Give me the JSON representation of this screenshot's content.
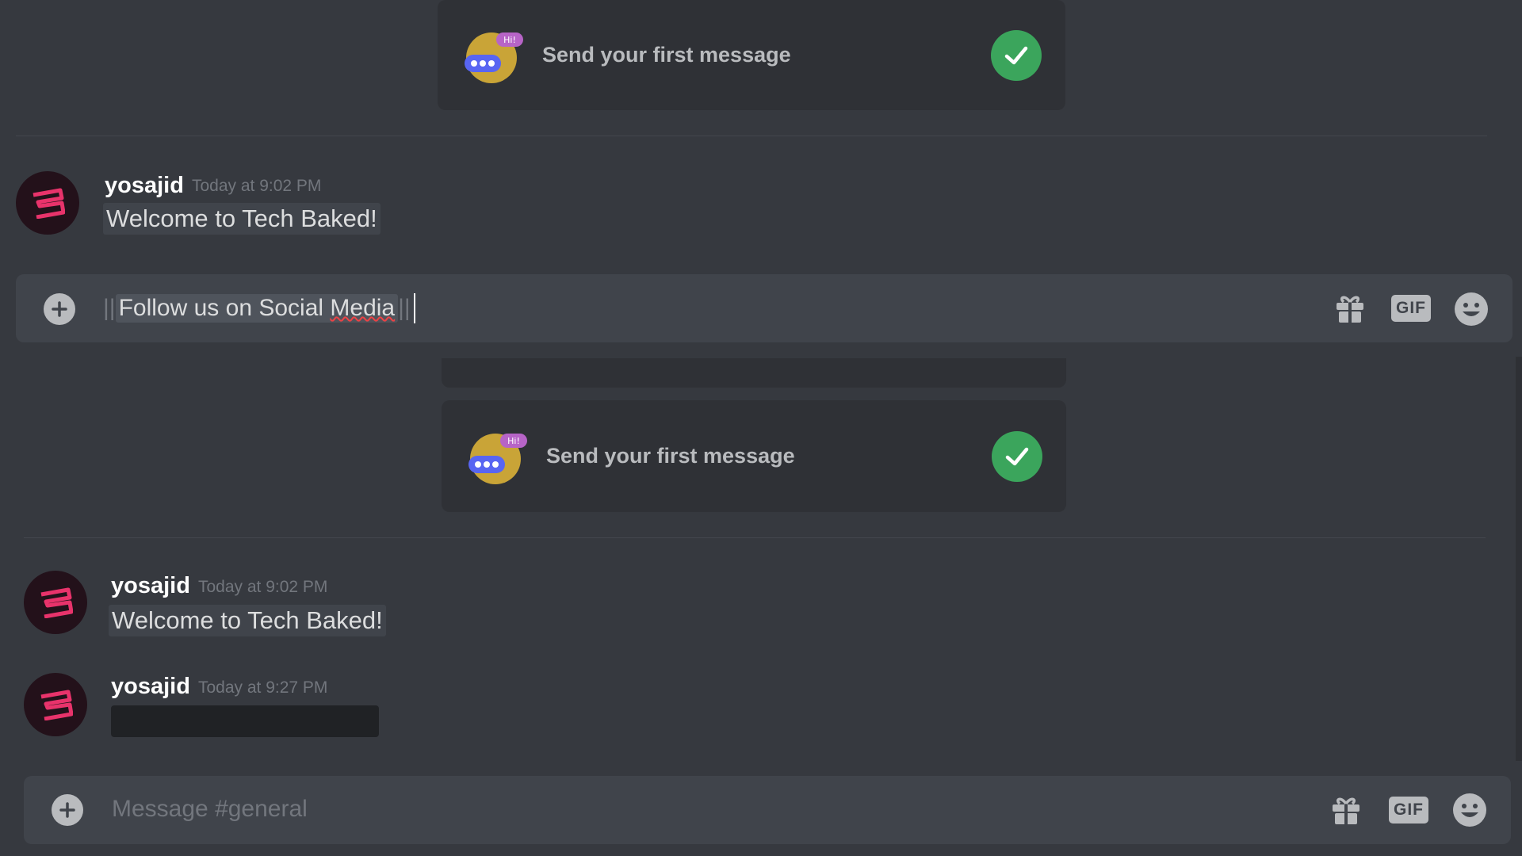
{
  "welcome_cards": [
    {
      "title": "Send your first message",
      "badge": "Hi!"
    },
    {
      "title": "Send your first message",
      "badge": "Hi!"
    }
  ],
  "messages_top": [
    {
      "username": "yosajid",
      "timestamp": "Today at 9:02 PM",
      "text": "Welcome to Tech Baked!"
    }
  ],
  "messages_bottom": [
    {
      "username": "yosajid",
      "timestamp": "Today at 9:02 PM",
      "text": "Welcome to Tech Baked!"
    },
    {
      "username": "yosajid",
      "timestamp": "Today at 9:27 PM",
      "text": ""
    }
  ],
  "edit_composer": {
    "spoiler_open": "||",
    "value_part1": "Follow us on Social ",
    "value_part2": "Media",
    "spoiler_close": "||"
  },
  "main_composer": {
    "placeholder": "Message #general"
  },
  "toolbar": {
    "gif_label": "GIF"
  },
  "icons": {
    "add": "plus-circle-icon",
    "gift": "gift-icon",
    "gif": "gif-icon",
    "emoji": "emoji-smile-icon",
    "check": "checkmark-icon"
  },
  "colors": {
    "background": "#36393f",
    "card": "#2f3136",
    "composer": "#40444b",
    "check_green": "#3ba55c",
    "avatar_accent": "#e8336b",
    "misspell_red": "#ed4245"
  }
}
